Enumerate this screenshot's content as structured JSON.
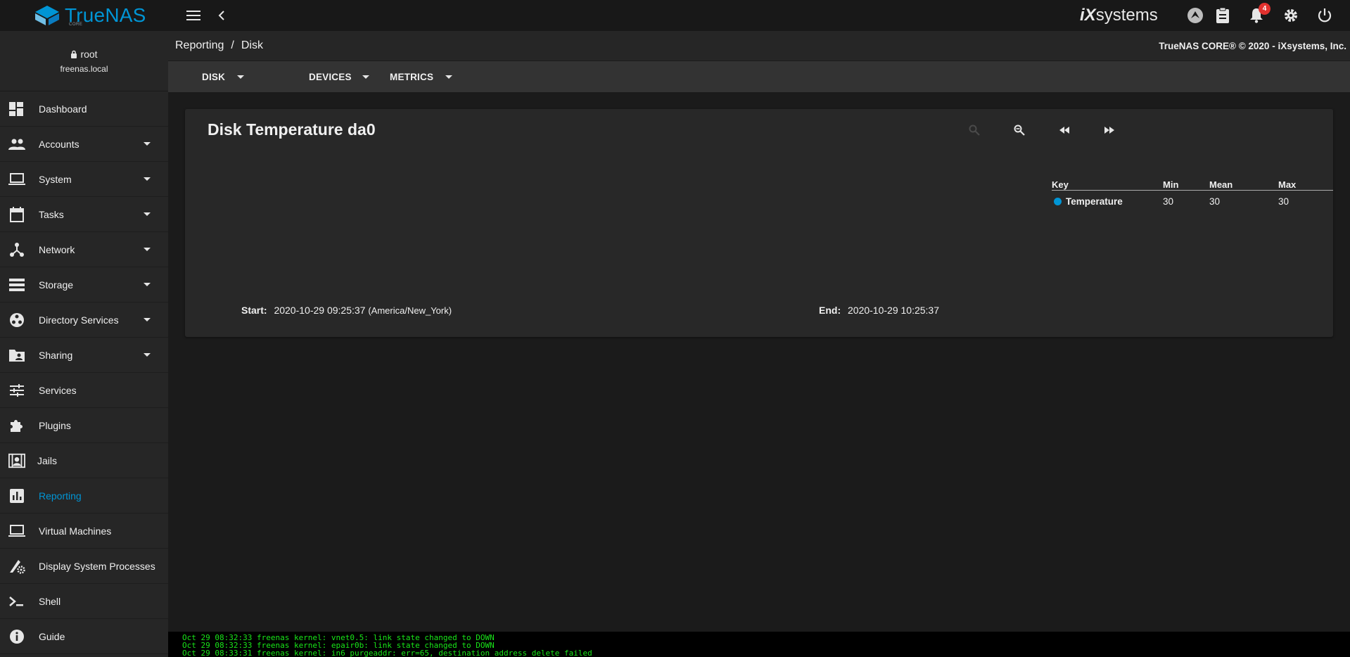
{
  "brand": {
    "name": "TrueNAS",
    "edition": "CORE",
    "vendor": "systems",
    "vendor_prefix": "iX"
  },
  "topbar": {
    "notification_count": "4"
  },
  "user": {
    "name": "root",
    "host": "freenas.local"
  },
  "sidebar": {
    "items": [
      {
        "label": "Dashboard",
        "icon": "dashboard-icon",
        "caret": false
      },
      {
        "label": "Accounts",
        "icon": "people-icon",
        "caret": true
      },
      {
        "label": "System",
        "icon": "laptop-icon",
        "caret": true
      },
      {
        "label": "Tasks",
        "icon": "calendar-icon",
        "caret": true
      },
      {
        "label": "Network",
        "icon": "network-icon",
        "caret": true
      },
      {
        "label": "Storage",
        "icon": "storage-icon",
        "caret": true
      },
      {
        "label": "Directory Services",
        "icon": "directory-icon",
        "caret": true
      },
      {
        "label": "Sharing",
        "icon": "folder-shared-icon",
        "caret": true
      },
      {
        "label": "Services",
        "icon": "tune-icon",
        "caret": false
      },
      {
        "label": "Plugins",
        "icon": "puzzle-icon",
        "caret": false
      },
      {
        "label": "Jails",
        "icon": "jail-icon",
        "caret": false
      },
      {
        "label": "Reporting",
        "icon": "chart-icon",
        "caret": false,
        "active": true
      },
      {
        "label": "Virtual Machines",
        "icon": "laptop-icon",
        "caret": false
      },
      {
        "label": "Display System Processes",
        "icon": "processes-icon",
        "caret": false
      },
      {
        "label": "Shell",
        "icon": "shell-icon",
        "caret": false
      },
      {
        "label": "Guide",
        "icon": "info-icon",
        "caret": false
      }
    ]
  },
  "breadcrumb": {
    "parent": "Reporting",
    "separator": "/",
    "current": "Disk"
  },
  "copyright": "TrueNAS CORE® © 2020 - iXsystems, Inc.",
  "toolbar": {
    "disk": "DISK",
    "devices": "DEVICES",
    "metrics": "METRICS"
  },
  "card": {
    "title": "Disk Temperature da0",
    "legend": {
      "headers": {
        "key": "Key",
        "min": "Min",
        "mean": "Mean",
        "max": "Max"
      },
      "rows": [
        {
          "name": "Temperature",
          "min": "30",
          "mean": "30",
          "max": "30",
          "color": "#0095d5"
        }
      ]
    },
    "start_label": "Start:",
    "start_value": "2020-10-29 09:25:37",
    "start_tz": "(America/New_York)",
    "end_label": "End:",
    "end_value": "2020-10-29 10:25:37"
  },
  "console": {
    "lines": [
      "Oct 29 08:32:33 freenas kernel: vnet0.5: link state changed to DOWN",
      "Oct 29 08:32:33 freenas kernel: epair0b: link state changed to DOWN",
      "Oct 29 08:33:31 freenas kernel: in6_purgeaddr: err=65, destination address delete failed"
    ]
  }
}
